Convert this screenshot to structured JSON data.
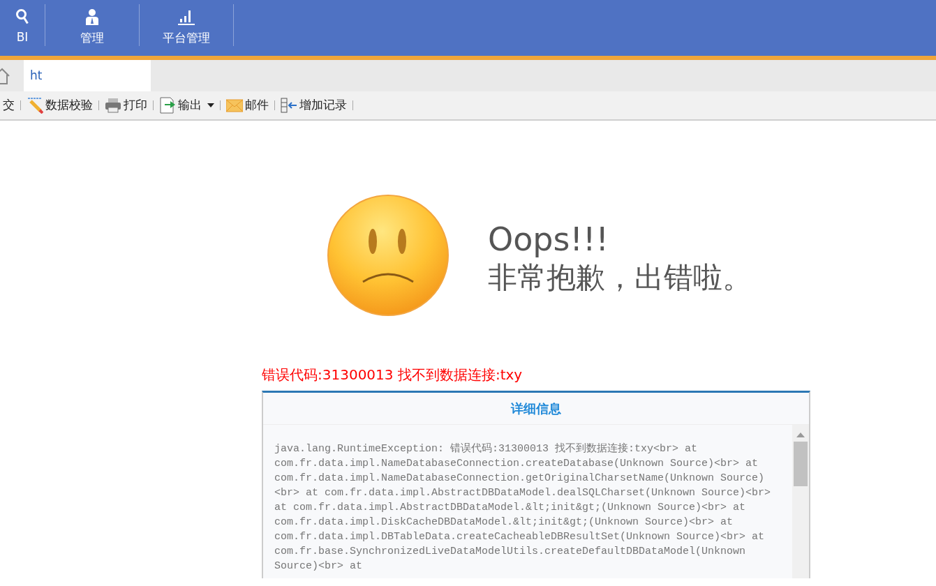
{
  "top_nav": [
    {
      "label": "BI",
      "kind": "search"
    },
    {
      "label": "管理",
      "kind": "person"
    },
    {
      "label": "平台管理",
      "kind": "chart"
    }
  ],
  "tabs": [
    {
      "label": "ht",
      "selected": true
    }
  ],
  "toolbar": [
    {
      "label": "交",
      "kind": "plain"
    },
    {
      "label": "数据校验",
      "kind": "validate"
    },
    {
      "label": "打印",
      "kind": "print"
    },
    {
      "label": "输出",
      "kind": "export",
      "dropdown": true
    },
    {
      "label": "邮件",
      "kind": "mail"
    },
    {
      "label": "增加记录",
      "kind": "add-row"
    }
  ],
  "error": {
    "title": "Oops!!!",
    "message": "非常抱歉，出错啦。",
    "code_line": "错误代码:31300013 找不到数据连接:txy"
  },
  "details": {
    "title": "详细信息",
    "lines": [
      "java.lang.RuntimeException: 错误代码:31300013 找不到数据连接:txy<br> at",
      "com.fr.data.impl.NameDatabaseConnection.createDatabase(Unknown Source)<br> at",
      "com.fr.data.impl.NameDatabaseConnection.getOriginalCharsetName(Unknown Source)",
      "<br> at com.fr.data.impl.AbstractDBDataModel.dealSQLCharset(Unknown Source)<br>",
      "at com.fr.data.impl.AbstractDBDataModel.&lt;init&gt;(Unknown Source)<br> at",
      "com.fr.data.impl.DiskCacheDBDataModel.&lt;init&gt;(Unknown Source)<br> at",
      "com.fr.data.impl.DBTableData.createCacheableDBResultSet(Unknown Source)<br> at",
      "com.fr.base.SynchronizedLiveDataModelUtils.createDefaultDBDataModel(Unknown",
      "Source)<br> at"
    ]
  }
}
